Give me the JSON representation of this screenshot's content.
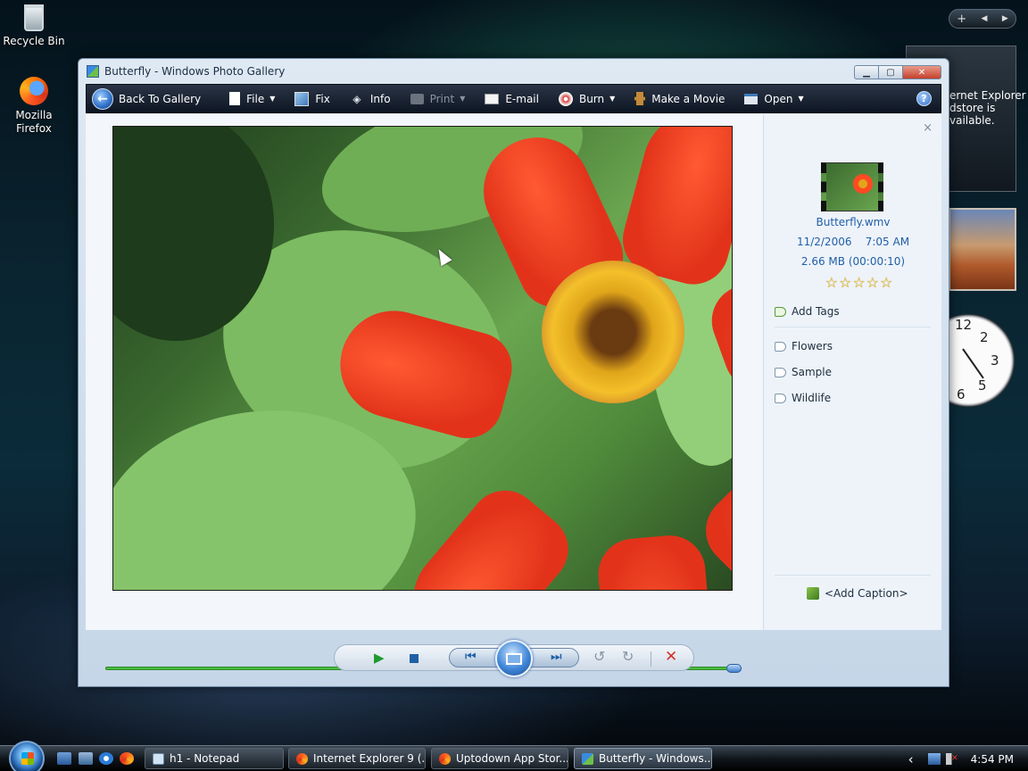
{
  "desktop": {
    "icons": [
      {
        "label": "Recycle Bin"
      },
      {
        "label": "Mozilla Firefox"
      }
    ],
    "ie_gadget_text": "ernet Explorer\ndstore is\nvailable."
  },
  "window": {
    "title": "Butterfly - Windows Photo Gallery",
    "buttons": {
      "minimize": "▁",
      "maximize": "▢",
      "close": "✕"
    }
  },
  "toolbar": {
    "back": "Back To Gallery",
    "file": "File",
    "fix": "Fix",
    "info": "Info",
    "print": "Print",
    "email": "E-mail",
    "burn": "Burn",
    "movie": "Make a Movie",
    "open": "Open",
    "help": "?"
  },
  "info_pane": {
    "close": "×",
    "filename": "Butterfly.wmv",
    "date": "11/2/2006    7:05 AM",
    "size": "2.66 MB (00:00:10)",
    "stars": "☆☆☆☆☆",
    "rating": 0,
    "add_tags": "Add Tags",
    "tags": [
      "Flowers",
      "Sample",
      "Wildlife"
    ],
    "add_caption": "<Add Caption>"
  },
  "playback": {
    "progress": 1.0,
    "play": "▶",
    "prev": "⏮",
    "next": "⏭",
    "rotate_left": "↺",
    "rotate_right": "↻",
    "delete": "✕"
  },
  "taskbar": {
    "tasks": [
      {
        "label": "h1 - Notepad"
      },
      {
        "label": "Internet Explorer 9 (..."
      },
      {
        "label": "Uptodown App Stor..."
      },
      {
        "label": "Butterfly - Windows..."
      }
    ],
    "tray_chevron": "‹",
    "time": "4:54 PM"
  },
  "colors": {
    "toolbar_bg": "#0d1522",
    "link_blue": "#1f5fa6",
    "seek_green": "#4bbb3f",
    "delete_red": "#d2322a"
  }
}
